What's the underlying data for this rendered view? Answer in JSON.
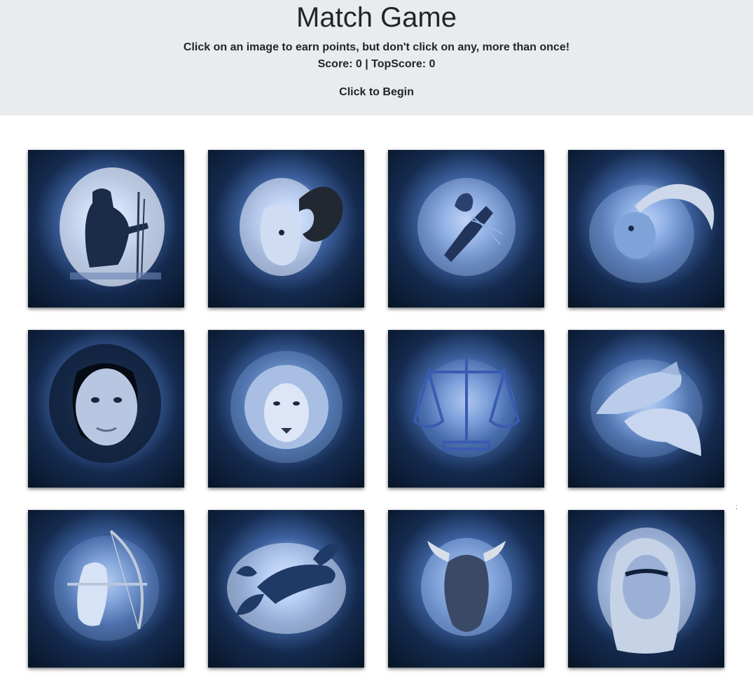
{
  "header": {
    "title": "Match Game",
    "instructions": "Click on an image to earn points, but don't click on any, more than once!",
    "score_label": "Score: ",
    "score": "0",
    "separator": " | ",
    "top_score_label": "TopScore: ",
    "top_score": "0",
    "status": "Click to Begin"
  },
  "stray_mark": ";",
  "cards": [
    {
      "icon": "aquarius-icon"
    },
    {
      "icon": "aries-icon"
    },
    {
      "icon": "cancer-icon"
    },
    {
      "icon": "capricorn-icon"
    },
    {
      "icon": "gemini-icon"
    },
    {
      "icon": "leo-icon"
    },
    {
      "icon": "libra-icon"
    },
    {
      "icon": "pisces-icon"
    },
    {
      "icon": "sagittarius-icon"
    },
    {
      "icon": "scorpio-icon"
    },
    {
      "icon": "taurus-icon"
    },
    {
      "icon": "virgo-icon"
    }
  ]
}
